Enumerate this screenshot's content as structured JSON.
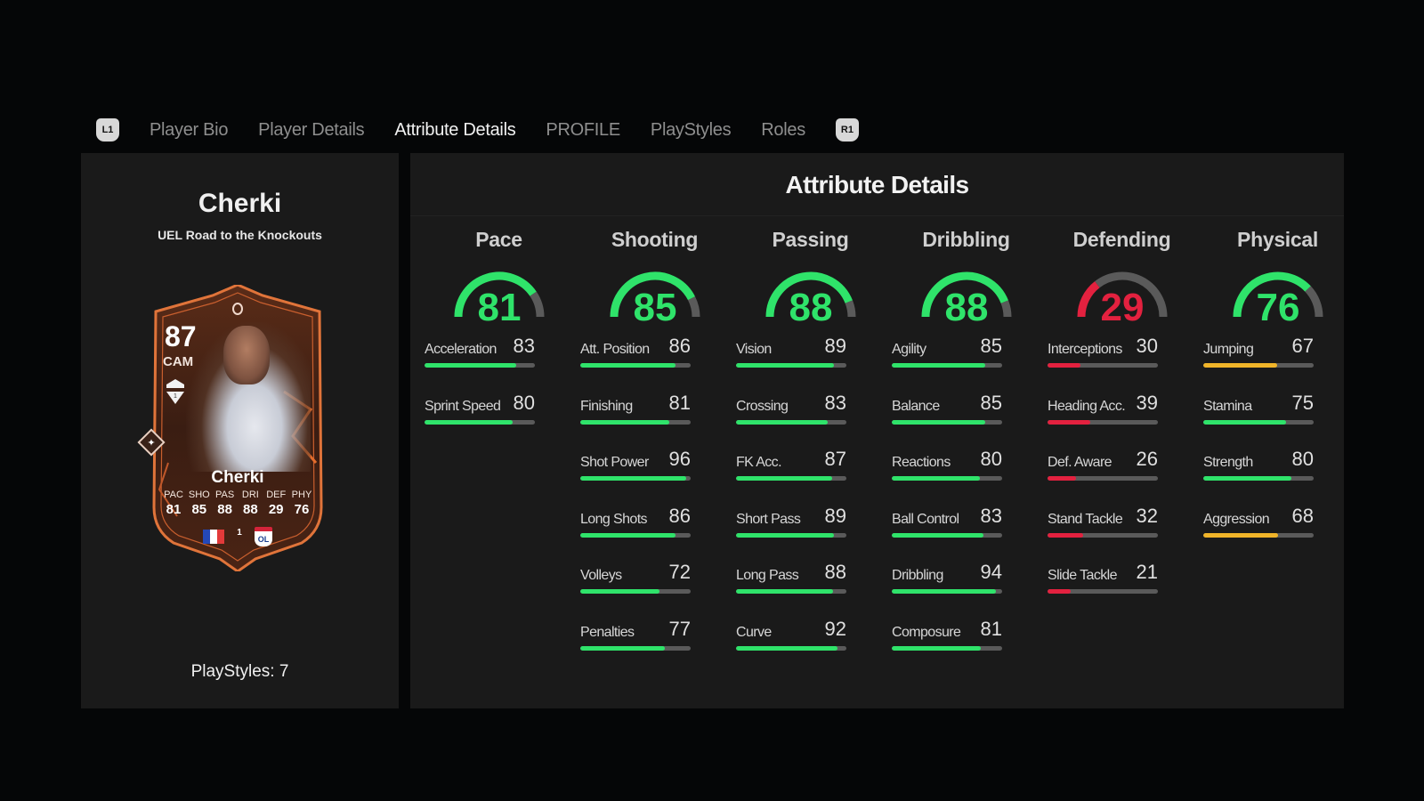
{
  "tabs": {
    "left_bumper": "L1",
    "right_bumper": "R1",
    "items": [
      {
        "label": "Player Bio",
        "active": false
      },
      {
        "label": "Player Details",
        "active": false
      },
      {
        "label": "Attribute Details",
        "active": true
      },
      {
        "label": "PROFILE",
        "active": false
      },
      {
        "label": "PlayStyles",
        "active": false
      },
      {
        "label": "Roles",
        "active": false
      }
    ]
  },
  "player": {
    "name": "Cherki",
    "card_version": "UEL Road to the Knockouts",
    "playstyles_label": "PlayStyles: 7",
    "card": {
      "rating": "87",
      "position": "CAM",
      "name": "Cherki",
      "stats": [
        {
          "label": "PAC",
          "value": "81"
        },
        {
          "label": "SHO",
          "value": "85"
        },
        {
          "label": "PAS",
          "value": "88"
        },
        {
          "label": "DRI",
          "value": "88"
        },
        {
          "label": "DEF",
          "value": "29"
        },
        {
          "label": "PHY",
          "value": "76"
        }
      ],
      "nation": "France",
      "league": "Ligue 1",
      "club": "OL",
      "club_label": "OL",
      "league_mark": "1"
    }
  },
  "attributes": {
    "title": "Attribute Details",
    "colors": {
      "green": "#2fe36a",
      "yellow": "#f0b429",
      "red": "#e3213f",
      "track": "#5a5a5a"
    },
    "categories": [
      {
        "name": "Pace",
        "value": 81,
        "stats": [
          {
            "name": "Acceleration",
            "value": 83
          },
          {
            "name": "Sprint Speed",
            "value": 80
          }
        ]
      },
      {
        "name": "Shooting",
        "value": 85,
        "stats": [
          {
            "name": "Att. Position",
            "value": 86
          },
          {
            "name": "Finishing",
            "value": 81
          },
          {
            "name": "Shot Power",
            "value": 96
          },
          {
            "name": "Long Shots",
            "value": 86
          },
          {
            "name": "Volleys",
            "value": 72
          },
          {
            "name": "Penalties",
            "value": 77
          }
        ]
      },
      {
        "name": "Passing",
        "value": 88,
        "stats": [
          {
            "name": "Vision",
            "value": 89
          },
          {
            "name": "Crossing",
            "value": 83
          },
          {
            "name": "FK Acc.",
            "value": 87
          },
          {
            "name": "Short Pass",
            "value": 89
          },
          {
            "name": "Long Pass",
            "value": 88
          },
          {
            "name": "Curve",
            "value": 92
          }
        ]
      },
      {
        "name": "Dribbling",
        "value": 88,
        "stats": [
          {
            "name": "Agility",
            "value": 85
          },
          {
            "name": "Balance",
            "value": 85
          },
          {
            "name": "Reactions",
            "value": 80
          },
          {
            "name": "Ball Control",
            "value": 83
          },
          {
            "name": "Dribbling",
            "value": 94
          },
          {
            "name": "Composure",
            "value": 81
          }
        ]
      },
      {
        "name": "Defending",
        "value": 29,
        "stats": [
          {
            "name": "Interceptions",
            "value": 30
          },
          {
            "name": "Heading Acc.",
            "value": 39
          },
          {
            "name": "Def. Aware",
            "value": 26
          },
          {
            "name": "Stand Tackle",
            "value": 32
          },
          {
            "name": "Slide Tackle",
            "value": 21
          }
        ]
      },
      {
        "name": "Physical",
        "value": 76,
        "stats": [
          {
            "name": "Jumping",
            "value": 67
          },
          {
            "name": "Stamina",
            "value": 75
          },
          {
            "name": "Strength",
            "value": 80
          },
          {
            "name": "Aggression",
            "value": 68
          }
        ]
      }
    ]
  }
}
